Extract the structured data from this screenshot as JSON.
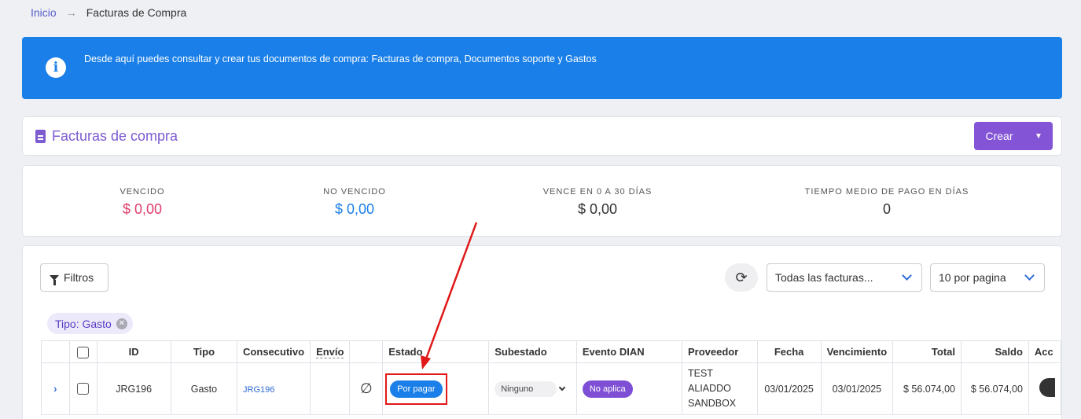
{
  "breadcrumb": {
    "home": "Inicio",
    "separator": "→",
    "current": "Facturas de Compra"
  },
  "alert": {
    "icon": "info-icon",
    "message": "Desde aquí puedes consultar y crear tus documentos de compra: Facturas de compra, Documentos soporte y Gastos"
  },
  "page": {
    "title": "Facturas de compra",
    "create_label": "Crear"
  },
  "stats": [
    {
      "label": "VENCIDO",
      "value": "$ 0,00",
      "color": "#e23b6a"
    },
    {
      "label": "NO VENCIDO",
      "value": "$ 0,00",
      "color": "#1a7fe8"
    },
    {
      "label": "VENCE EN 0 A 30 DÍAS",
      "value": "$ 0,00",
      "color": "#333333"
    },
    {
      "label": "TIEMPO MEDIO DE PAGO EN DÍAS",
      "value": "0",
      "color": "#333333"
    }
  ],
  "toolbar": {
    "filters_label": "Filtros",
    "invoice_filter": "Todas las facturas...",
    "per_page": "10 por pagina"
  },
  "active_filter": {
    "label": "Tipo: Gasto"
  },
  "table": {
    "headers": [
      "",
      "",
      "ID",
      "Tipo",
      "Consecutivo",
      "Envío",
      "",
      "Estado",
      "Subestado",
      "Evento DIAN",
      "Proveedor",
      "Fecha",
      "Vencimiento",
      "Total",
      "Saldo",
      "Acc"
    ],
    "rows": [
      {
        "id": "JRG196",
        "tipo": "Gasto",
        "consecutivo": "JRG196",
        "envio": "",
        "symbol": "∅",
        "estado": "Por pagar",
        "subestado": "Ninguno",
        "evento": "No aplica",
        "proveedor": "TEST ALIADDO SANDBOX",
        "fecha": "03/01/2025",
        "vencimiento": "03/01/2025",
        "total": "$ 56.074,00",
        "saldo": "$ 56.074,00"
      }
    ]
  },
  "colors": {
    "primary": "#8454d6",
    "info": "#1a7fe8",
    "annotation": "#e01818"
  }
}
